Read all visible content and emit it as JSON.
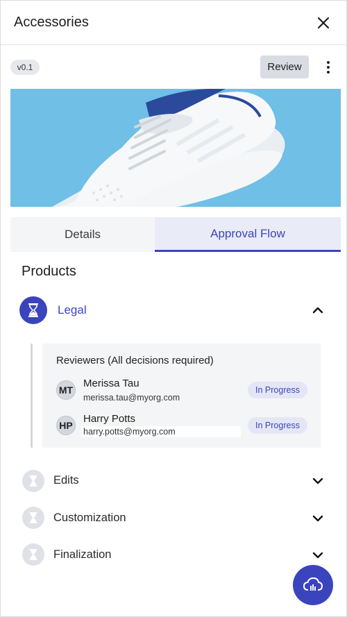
{
  "header": {
    "title": "Accessories"
  },
  "toolbar": {
    "version": "v0.1",
    "review_label": "Review"
  },
  "hero": {
    "image": "white-sneaker-photo"
  },
  "tabs": [
    {
      "label": "Details",
      "active": false
    },
    {
      "label": "Approval Flow",
      "active": true
    }
  ],
  "section": {
    "title": "Products"
  },
  "active_stage": {
    "label": "Legal",
    "reviewers_heading": "Reviewers (All decisions required)",
    "reviewers": [
      {
        "initials": "MT",
        "name": "Merissa Tau",
        "email": "merissa.tau@myorg.com",
        "status": "In Progress"
      },
      {
        "initials": "HP",
        "name": "Harry Potts",
        "email": "harry.potts@myorg.com",
        "status": "In Progress"
      }
    ]
  },
  "stages": [
    {
      "label": "Edits"
    },
    {
      "label": "Customization"
    },
    {
      "label": "Finalization"
    }
  ],
  "colors": {
    "accent": "#3a44bd",
    "badge_bg": "#e4e6f6",
    "hero_bg": "#6ebee4"
  }
}
